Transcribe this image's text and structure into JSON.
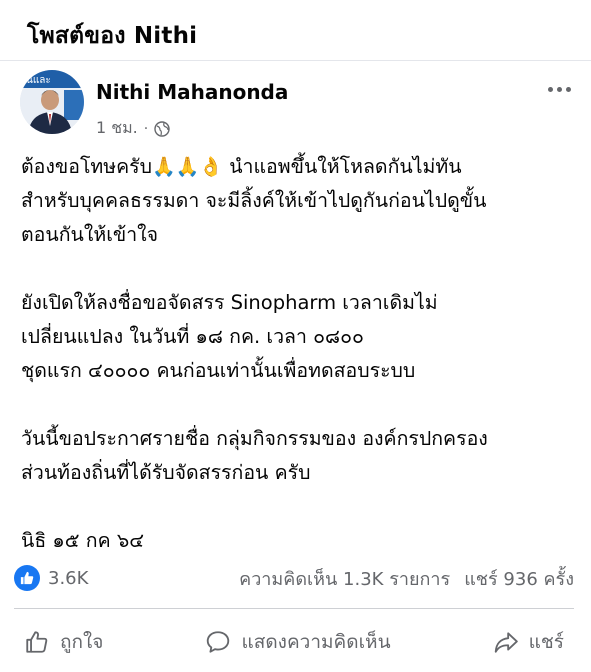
{
  "page": {
    "title": "โพสต์ของ Nithi"
  },
  "post": {
    "author": "Nithi Mahanonda",
    "time": "1 ชม.",
    "separator": "·",
    "lines": [
      "ต้องขอโทษครับ",
      "นำแอพขึ้นให้โหลดกันไม่ทัน",
      "สำหรับบุคคลธรรมดา จะมีลิ้งค์ให้เข้าไปดูกันก่อนไปดูขั้น",
      "ตอนกันให้เข้าใจ",
      "ยังเปิดให้ลงชื่อขอจัดสรร Sinopharm เวลาเดิมไม่",
      "เปลี่ยนแปลง ในวันที่ ๑๘ กค. เวลา ๐๘๐๐",
      "ชุดแรก ๔๐๐๐๐ คนก่อนเท่านั้นเพื่อทดสอบระบบ",
      "วันนี้ขอประกาศรายชื่อ กลุ่มกิจกรรมของ องค์กรปกครอง",
      "ส่วนท้องถิ่นที่ได้รับจัดสรรก่อน ครับ",
      "นิธิ ๑๕ กค ๖๔"
    ],
    "emojis": "🙏🙏👌",
    "avatar_text": "นและ"
  },
  "stats": {
    "likes": "3.6K",
    "comments": "ความคิดเห็น 1.3K รายการ",
    "shares": "แชร์ 936 ครั้ง"
  },
  "actions": {
    "like": "ถูกใจ",
    "comment": "แสดงความคิดเห็น",
    "share": "แชร์"
  },
  "icons": [
    "globe-icon",
    "more-icon",
    "like-icon",
    "comment-icon",
    "share-icon"
  ],
  "colors": {
    "accent": "#1877f2",
    "secondary_text": "#65676b"
  }
}
